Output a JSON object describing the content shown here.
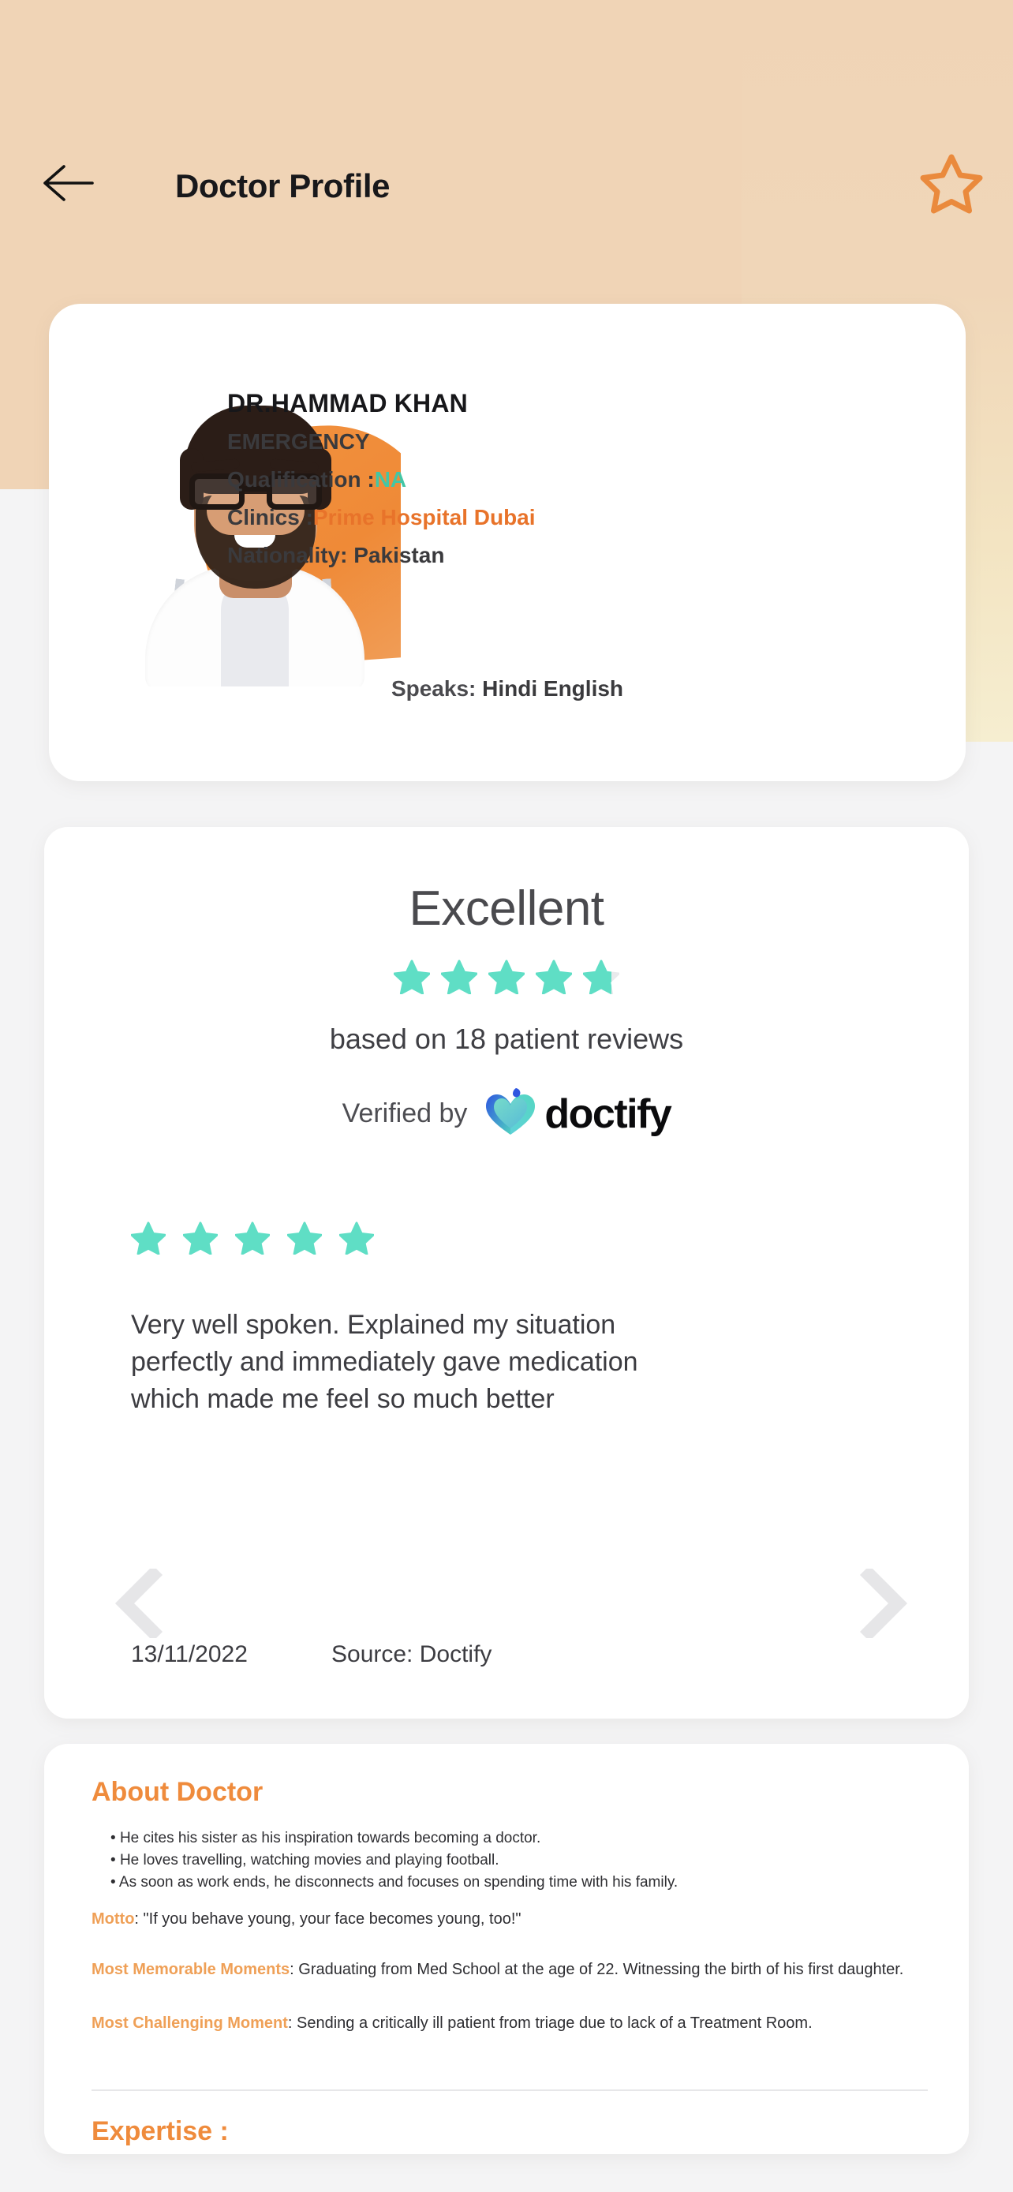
{
  "header": {
    "title": "Doctor Profile",
    "back_icon": "arrow-left-icon",
    "favorite_icon": "star-outline-icon",
    "background_color": "#f0d4b6"
  },
  "doctor": {
    "name": "DR.HAMMAD KHAN",
    "specialty": "EMERGENCY",
    "qualification_label": "Qualification :",
    "qualification_value": "NA",
    "clinics_label": "Clinics :",
    "clinics_value": "Prime Hospital Dubai",
    "nationality_label": "Nationality:",
    "nationality_value": "Pakistan",
    "speaks_label": "Speaks:",
    "speaks_value": "Hindi English",
    "photo_alt": "doctor-portrait",
    "accent_green": "#43c6a5",
    "accent_orange": "#e8732a"
  },
  "reviews": {
    "rating_word": "Excellent",
    "rating_stars_filled": 4.8,
    "rating_stars_total": 5,
    "count_text": "based on 18 patient reviews",
    "review_count": 18,
    "verified_by_label": "Verified by",
    "verified_brand": "doctify",
    "star_color": "#5fdec5",
    "current_review": {
      "stars": 5,
      "text": "Very well spoken. Explained my situation perfectly and immediately gave medication which made me feel so much better",
      "date": "13/11/2022",
      "source": "Source: Doctify"
    },
    "prev_icon": "chevron-left-icon",
    "next_icon": "chevron-right-icon"
  },
  "about": {
    "title": "About Doctor",
    "bullets": [
      "He cites his sister as his inspiration towards becoming a doctor.",
      "He loves travelling, watching movies and playing football.",
      "As soon as work ends, he disconnects and focuses on spending time with his family."
    ],
    "motto_label": "Motto",
    "motto_value": ": \"If you behave young, your face becomes young, too!\"",
    "memorable_label": "Most Memorable Moments",
    "memorable_value": ": Graduating from Med School at the age of 22. Witnessing the birth of his first daughter.",
    "challenging_label": "Most Challenging Moment",
    "challenging_value": ":  Sending a critically ill patient from triage due to lack of a Treatment Room.",
    "expertise_title": "Expertise :",
    "label_color": "#efa057",
    "title_color": "#ef8b3c"
  }
}
